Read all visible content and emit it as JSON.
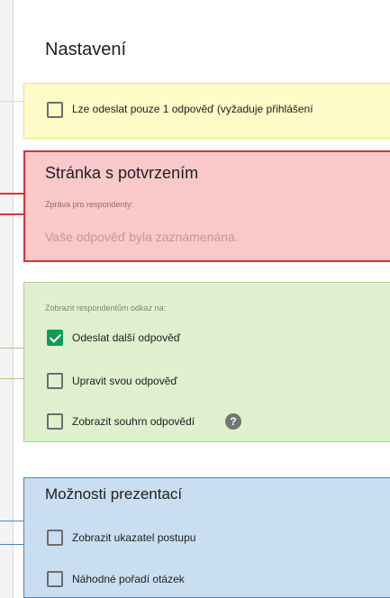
{
  "settings": {
    "title": "Nastavení",
    "one_response": {
      "label": "Lze odeslat pouze 1 odpověď (vyžaduje přihlášení",
      "checked": false
    },
    "confirmation": {
      "heading": "Stránka s potvrzením",
      "message_label": "Zpráva pro respondenty:",
      "message_value": "Vaše odpověď byla zaznamenána."
    },
    "respondent_links": {
      "heading": "Zobrazit respondentům odkaz na:",
      "items": [
        {
          "label": "Odeslat další odpověď",
          "checked": true
        },
        {
          "label": "Upravit svou odpověď",
          "checked": false
        },
        {
          "label": "Zobrazit souhrn odpovědí",
          "checked": false
        }
      ],
      "help_glyph": "?"
    },
    "presentation": {
      "heading": "Možnosti prezentací",
      "items": [
        {
          "label": "Zobrazit ukazatel postupu",
          "checked": false
        },
        {
          "label": "Náhodné pořadí otázek",
          "checked": false
        }
      ]
    }
  },
  "colors": {
    "yellow": "#fdfbc6",
    "red": "#f9c8c9",
    "green": "#dff0cf",
    "blue": "#c9def0",
    "check_green": "#0f9d58"
  },
  "icons": {
    "help": "help-circle-icon",
    "check": "checkmark-icon"
  }
}
